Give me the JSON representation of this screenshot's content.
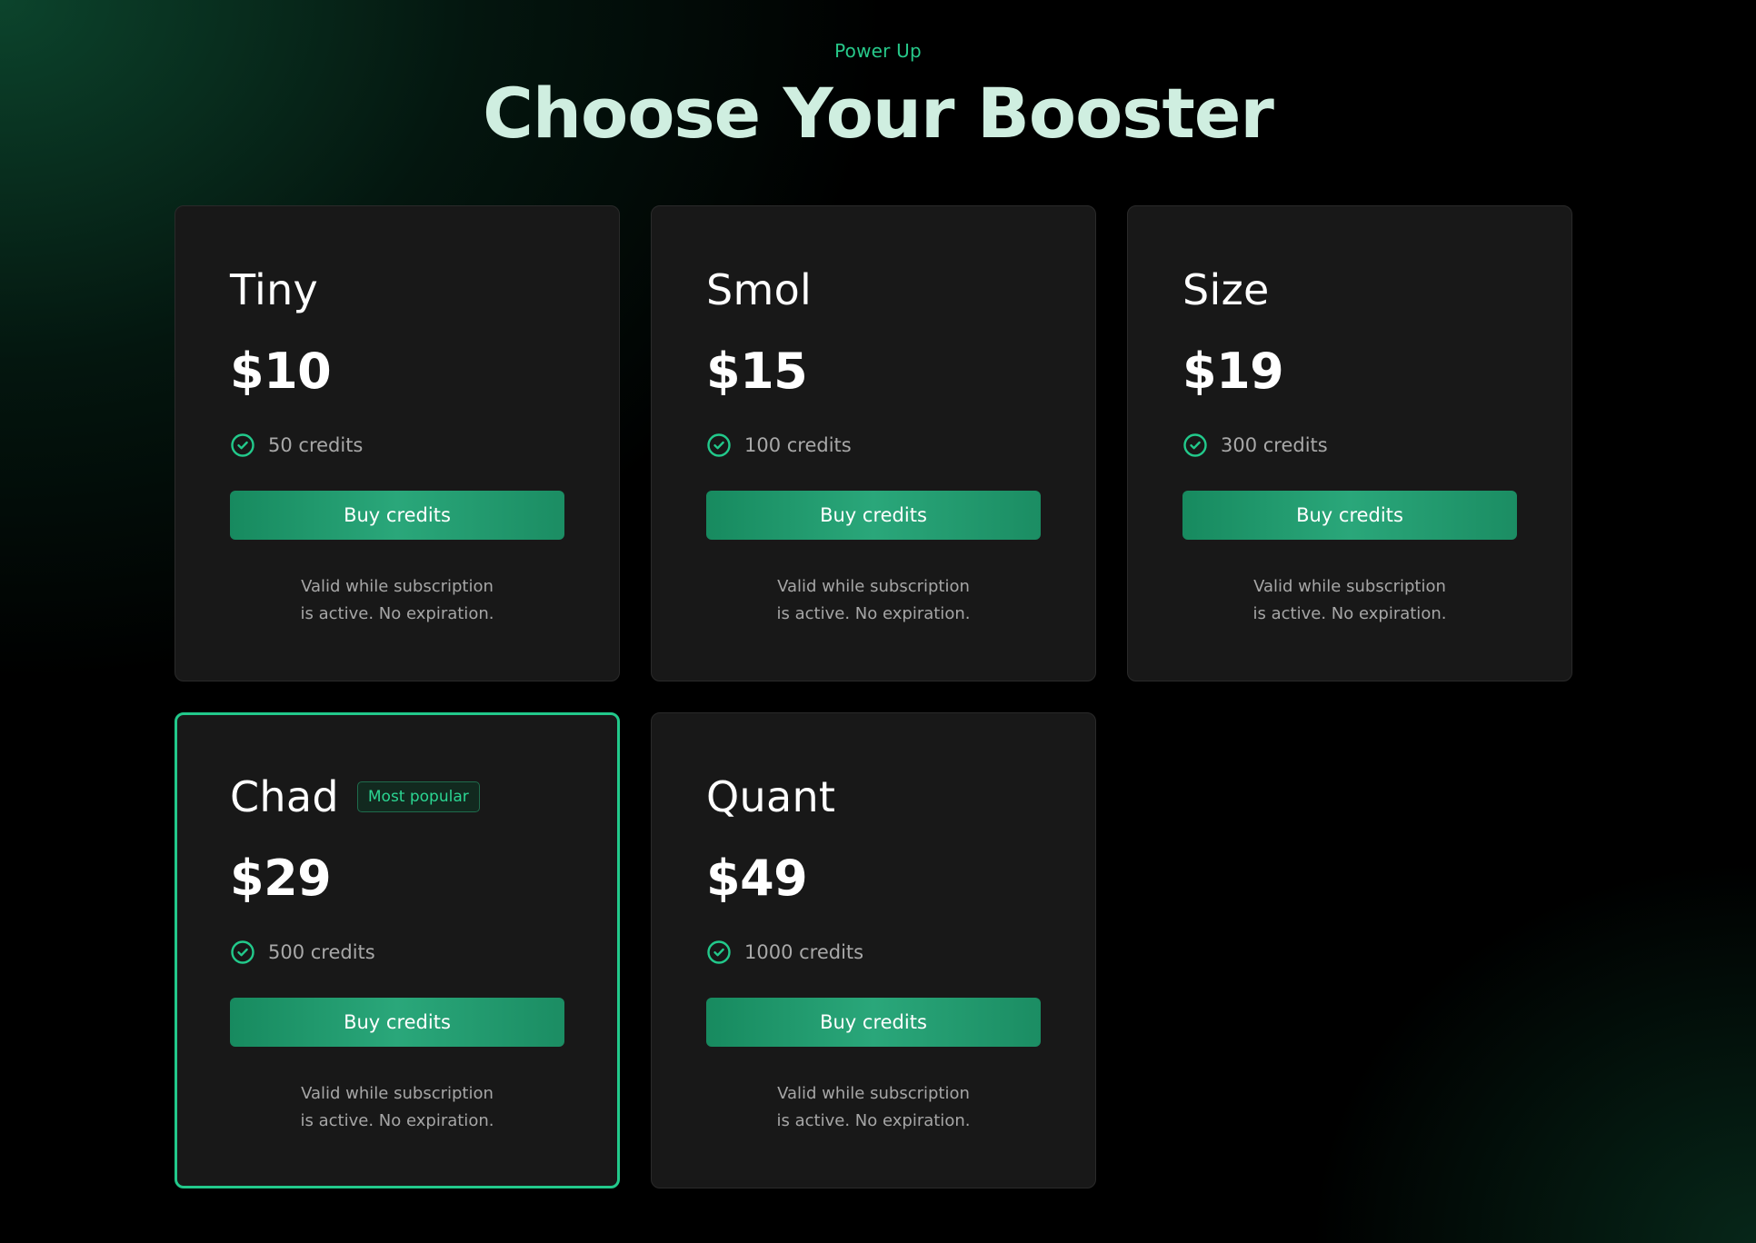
{
  "header": {
    "eyebrow": "Power Up",
    "title": "Choose Your Booster"
  },
  "colors": {
    "accent": "#22c98b",
    "card_bg": "#181818",
    "button_gradient_start": "#178a5f",
    "button_gradient_mid": "#2aa77a"
  },
  "plans": [
    {
      "name": "Tiny",
      "price": "$10",
      "credits": "50 credits",
      "button_label": "Buy credits",
      "note_line1": "Valid while subscription",
      "note_line2": "is active. No expiration."
    },
    {
      "name": "Smol",
      "price": "$15",
      "credits": "100 credits",
      "button_label": "Buy credits",
      "note_line1": "Valid while subscription",
      "note_line2": "is active. No expiration."
    },
    {
      "name": "Size",
      "price": "$19",
      "credits": "300 credits",
      "button_label": "Buy credits",
      "note_line1": "Valid while subscription",
      "note_line2": "is active. No expiration."
    },
    {
      "name": "Chad",
      "badge": "Most popular",
      "price": "$29",
      "credits": "500 credits",
      "button_label": "Buy credits",
      "note_line1": "Valid while subscription",
      "note_line2": "is active. No expiration."
    },
    {
      "name": "Quant",
      "price": "$49",
      "credits": "1000 credits",
      "button_label": "Buy credits",
      "note_line1": "Valid while subscription",
      "note_line2": "is active. No expiration."
    }
  ],
  "icons": {
    "feature_check": "check-circle-icon"
  }
}
